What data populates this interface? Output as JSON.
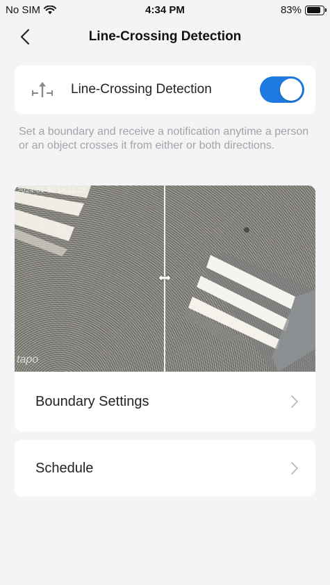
{
  "status_bar": {
    "carrier": "No SIM",
    "time": "4:34 PM",
    "battery_percent": "83%",
    "battery_level": 0.83
  },
  "nav": {
    "title": "Line-Crossing Detection",
    "back_icon": "chevron-left-icon"
  },
  "detection": {
    "label": "Line-Crossing Detection",
    "icon": "line-crossing-icon",
    "enabled": true,
    "accent_color": "#1e7ae0"
  },
  "description": "Set a boundary and receive a notification anytime a person or an object crosses it from either or both directions.",
  "preview": {
    "timestamp": "2024-01-30 14:21:22",
    "watermark": "tapo"
  },
  "menu": {
    "boundary_settings": "Boundary Settings",
    "schedule": "Schedule"
  }
}
